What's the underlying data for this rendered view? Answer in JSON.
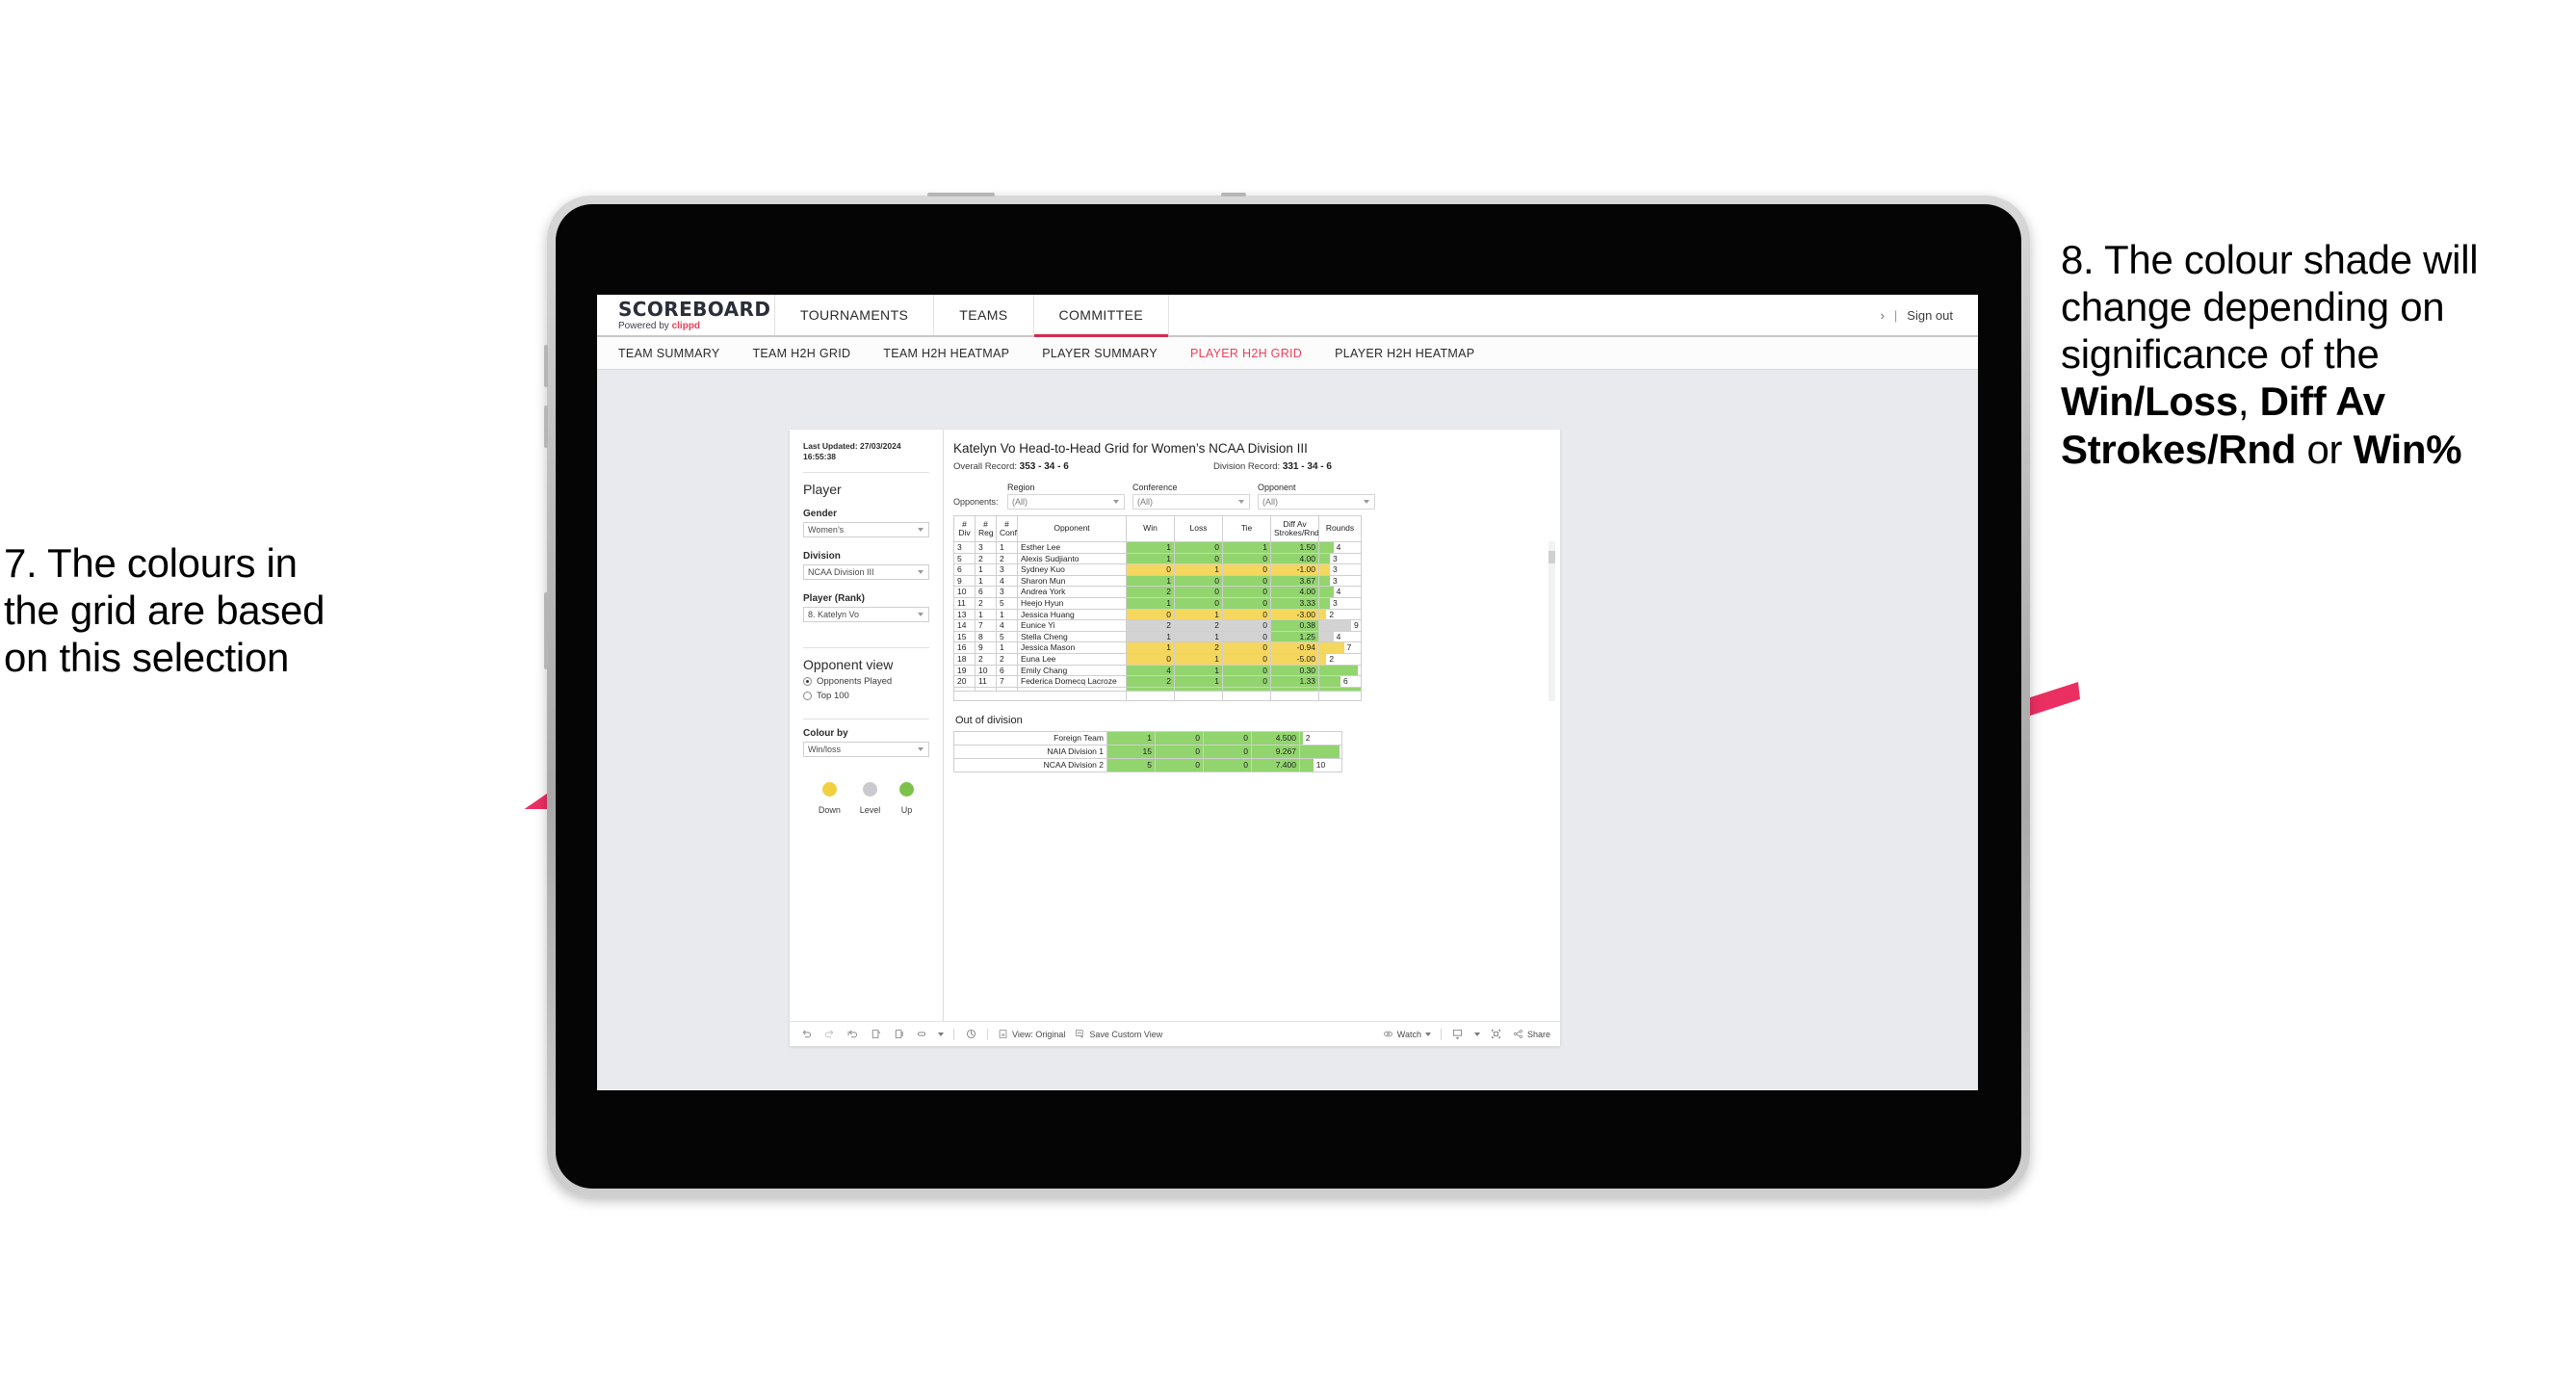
{
  "annotations": {
    "left": {
      "lines": [
        "7. The colours in",
        "the grid are based",
        "on this selection"
      ]
    },
    "right": {
      "segments": [
        {
          "text": "8. The colour shade will change depending on significance of the ",
          "bold": false
        },
        {
          "text": "Win/Loss",
          "bold": true
        },
        {
          "text": ", ",
          "bold": false
        },
        {
          "text": "Diff Av Strokes/Rnd",
          "bold": true
        },
        {
          "text": " or ",
          "bold": false
        },
        {
          "text": "Win%",
          "bold": true
        }
      ],
      "full_text": "8. The colour shade will change depending on significance of the Win/Loss, Diff Av Strokes/Rnd or Win%"
    },
    "arrow_color": "#ec2f63"
  },
  "header": {
    "brand_title": "SCOREBOARD",
    "brand_sub_prefix": "Powered by ",
    "brand_sub_accent": "clippd",
    "nav": [
      {
        "label": "TOURNAMENTS",
        "active": false
      },
      {
        "label": "TEAMS",
        "active": false
      },
      {
        "label": "COMMITTEE",
        "active": true
      }
    ],
    "chevron": "›",
    "separator": "|",
    "sign_out": "Sign out"
  },
  "subnav": [
    {
      "label": "TEAM SUMMARY",
      "active": false
    },
    {
      "label": "TEAM H2H GRID",
      "active": false
    },
    {
      "label": "TEAM H2H HEATMAP",
      "active": false
    },
    {
      "label": "PLAYER SUMMARY",
      "active": false
    },
    {
      "label": "PLAYER H2H GRID",
      "active": true
    },
    {
      "label": "PLAYER H2H HEATMAP",
      "active": false
    }
  ],
  "filters": {
    "last_updated": "Last Updated: 27/03/2024 16:55:38",
    "section_title": "Player",
    "gender_label": "Gender",
    "gender_value": "Women’s",
    "division_label": "Division",
    "division_value": "NCAA Division III",
    "player_label": "Player (Rank)",
    "player_value": "8. Katelyn Vo",
    "opponent_view_title": "Opponent view",
    "opponent_view_options": [
      {
        "label": "Opponents Played",
        "selected": true
      },
      {
        "label": "Top 100",
        "selected": false
      }
    ],
    "colour_by_label": "Colour by",
    "colour_by_value": "Win/loss",
    "legend": [
      {
        "label": "Down",
        "color": "#f2cf3f"
      },
      {
        "label": "Level",
        "color": "#c9cbcf"
      },
      {
        "label": "Up",
        "color": "#7cc24a"
      }
    ]
  },
  "viz": {
    "title": "Katelyn Vo Head-to-Head Grid for Women’s NCAA Division III",
    "overall_record_label": "Overall Record:",
    "overall_record_value": "353 -  34 - 6",
    "division_record_label": "Division Record:",
    "division_record_value": "331 -  34 - 6",
    "opponents_label": "Opponents:",
    "opponent_filters": [
      {
        "label": "Region",
        "value": "(All)"
      },
      {
        "label": "Conference",
        "value": "(All)"
      },
      {
        "label": "Opponent",
        "value": "(All)"
      }
    ]
  },
  "chart_data": {
    "type": "table",
    "title": "Katelyn Vo Head-to-Head Grid for Women’s NCAA Division III",
    "columns": [
      "# Div",
      "# Reg",
      "# Conf",
      "Opponent",
      "Win",
      "Loss",
      "Tie",
      "Diff Av Strokes/Rnd",
      "Rounds"
    ],
    "colour_by": "Win/loss",
    "colour_scale": {
      "up": "#92d56f",
      "down": "#f5d75e",
      "level": "#d3d3d3"
    },
    "rounds_max": 12,
    "rows": [
      {
        "div": "3",
        "reg": "3",
        "conf": "1",
        "opponent": "Esther Lee",
        "win": "1",
        "loss": "0",
        "tie": "1",
        "diff": "1.50",
        "rounds": "4",
        "state": "up"
      },
      {
        "div": "5",
        "reg": "2",
        "conf": "2",
        "opponent": "Alexis Sudjianto",
        "win": "1",
        "loss": "0",
        "tie": "0",
        "diff": "4.00",
        "rounds": "3",
        "state": "up"
      },
      {
        "div": "6",
        "reg": "1",
        "conf": "3",
        "opponent": "Sydney Kuo",
        "win": "0",
        "loss": "1",
        "tie": "0",
        "diff": "-1.00",
        "rounds": "3",
        "state": "down"
      },
      {
        "div": "9",
        "reg": "1",
        "conf": "4",
        "opponent": "Sharon Mun",
        "win": "1",
        "loss": "0",
        "tie": "0",
        "diff": "3.67",
        "rounds": "3",
        "state": "up"
      },
      {
        "div": "10",
        "reg": "6",
        "conf": "3",
        "opponent": "Andrea York",
        "win": "2",
        "loss": "0",
        "tie": "0",
        "diff": "4.00",
        "rounds": "4",
        "state": "up"
      },
      {
        "div": "11",
        "reg": "2",
        "conf": "5",
        "opponent": "Heejo Hyun",
        "win": "1",
        "loss": "0",
        "tie": "0",
        "diff": "3.33",
        "rounds": "3",
        "state": "up"
      },
      {
        "div": "13",
        "reg": "1",
        "conf": "1",
        "opponent": "Jessica Huang",
        "win": "0",
        "loss": "1",
        "tie": "0",
        "diff": "-3.00",
        "rounds": "2",
        "state": "down"
      },
      {
        "div": "14",
        "reg": "7",
        "conf": "4",
        "opponent": "Eunice Yi",
        "win": "2",
        "loss": "2",
        "tie": "0",
        "diff": "0.38",
        "rounds": "9",
        "state": "level",
        "diff_state": "up"
      },
      {
        "div": "15",
        "reg": "8",
        "conf": "5",
        "opponent": "Stella Cheng",
        "win": "1",
        "loss": "1",
        "tie": "0",
        "diff": "1.25",
        "rounds": "4",
        "state": "level",
        "diff_state": "up"
      },
      {
        "div": "16",
        "reg": "9",
        "conf": "1",
        "opponent": "Jessica Mason",
        "win": "1",
        "loss": "2",
        "tie": "0",
        "diff": "-0.94",
        "rounds": "7",
        "state": "down"
      },
      {
        "div": "18",
        "reg": "2",
        "conf": "2",
        "opponent": "Euna Lee",
        "win": "0",
        "loss": "1",
        "tie": "0",
        "diff": "-5.00",
        "rounds": "2",
        "state": "down"
      },
      {
        "div": "19",
        "reg": "10",
        "conf": "6",
        "opponent": "Emily Chang",
        "win": "4",
        "loss": "1",
        "tie": "0",
        "diff": "0.30",
        "rounds": "11",
        "state": "up"
      },
      {
        "div": "20",
        "reg": "11",
        "conf": "7",
        "opponent": "Federica Domecq Lacroze",
        "win": "2",
        "loss": "1",
        "tie": "0",
        "diff": "1.33",
        "rounds": "6",
        "state": "up"
      }
    ]
  },
  "out_of_division": {
    "title": "Out of division",
    "rounds_max": 32,
    "rows": [
      {
        "name": "Foreign Team",
        "win": "1",
        "loss": "0",
        "tie": "0",
        "diff": "4.500",
        "rounds": "2",
        "state": "up"
      },
      {
        "name": "NAIA Division 1",
        "win": "15",
        "loss": "0",
        "tie": "0",
        "diff": "9.267",
        "rounds": "30",
        "state": "up"
      },
      {
        "name": "NCAA Division 2",
        "win": "5",
        "loss": "0",
        "tie": "0",
        "diff": "7.400",
        "rounds": "10",
        "state": "up"
      }
    ]
  },
  "toolbar": {
    "icons": [
      "undo-icon",
      "redo-icon",
      "revert-icon",
      "refresh-icon",
      "pause-icon",
      "filter-icon"
    ],
    "view_original": "View: Original",
    "save_custom_view": "Save Custom View",
    "watch": "Watch",
    "share": "Share"
  }
}
